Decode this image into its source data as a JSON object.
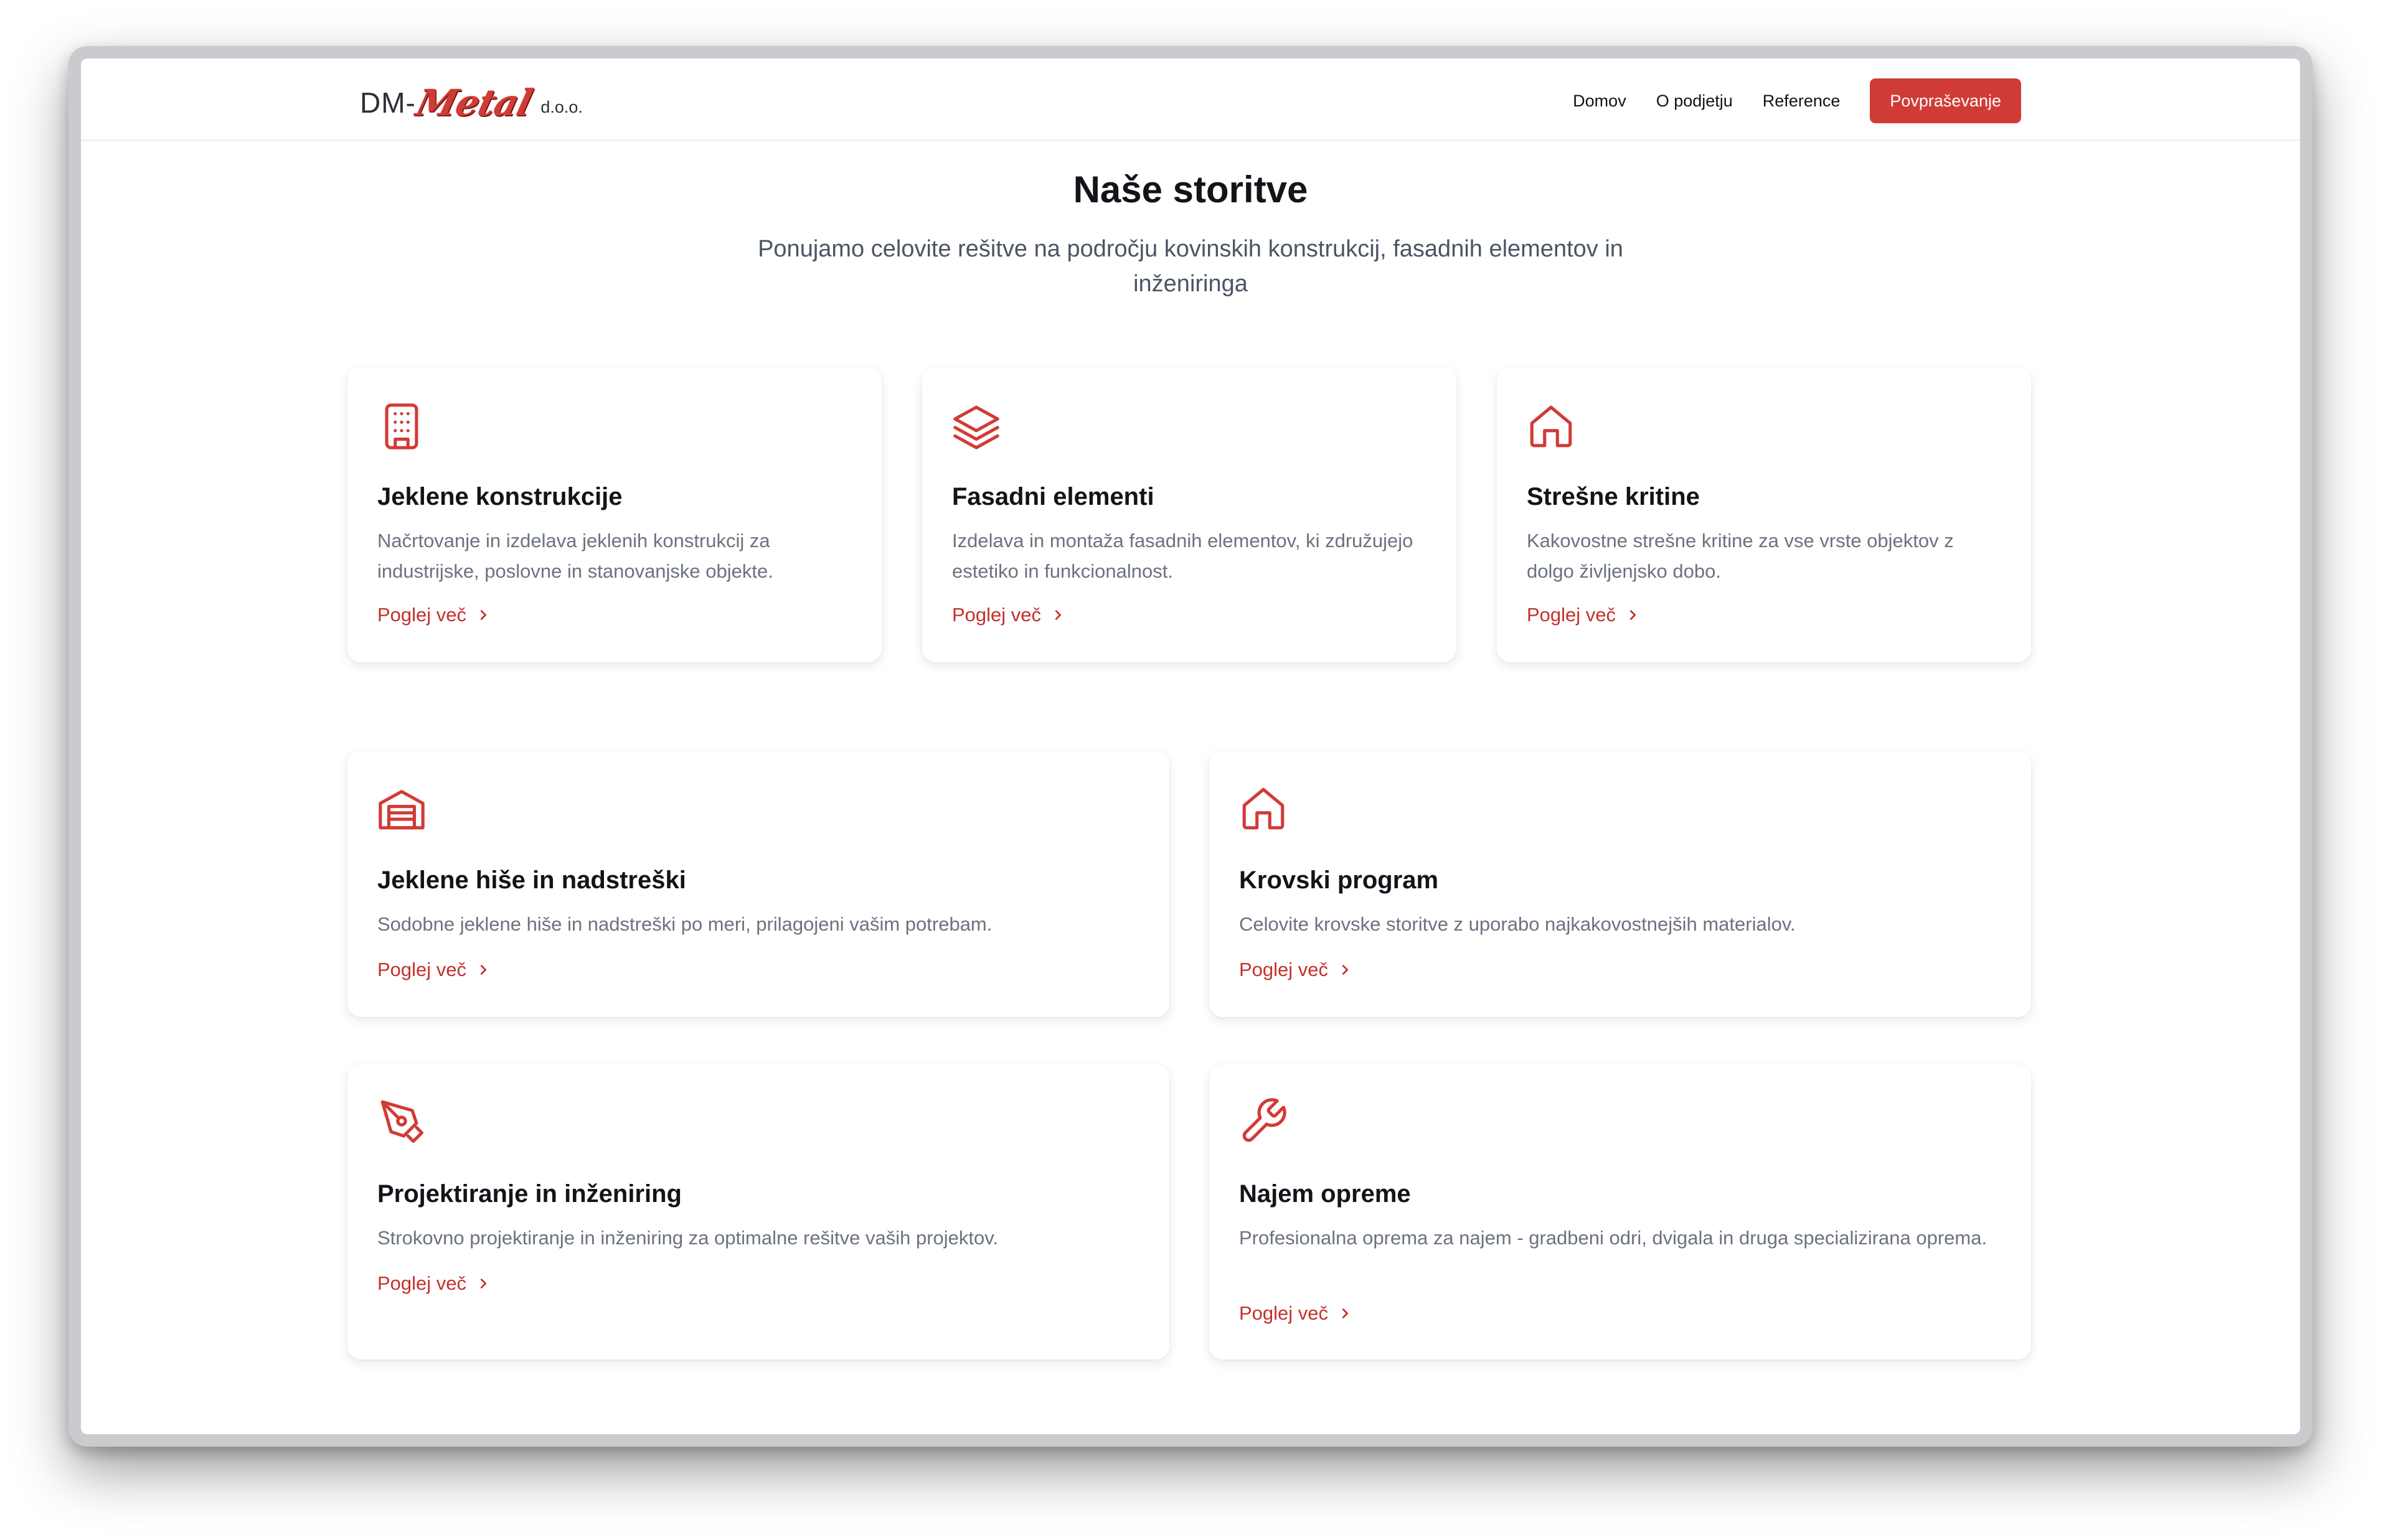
{
  "brand": {
    "logo_part1": "DM-",
    "logo_part2": "Metal",
    "logo_part3": "d.o.o.",
    "accent_color": "#d13b36"
  },
  "nav": {
    "items": [
      "Domov",
      "O podjetju",
      "Reference"
    ],
    "cta_label": "Povpraševanje"
  },
  "hero": {
    "title": "Naše storitve",
    "subtitle": "Ponujamo celovite rešitve na področju kovinskih konstrukcij, fasadnih elementov in inženiringa"
  },
  "services": [
    {
      "icon": "building-icon",
      "title": "Jeklene konstrukcije",
      "description": "Načrtovanje in izdelava jeklenih konstrukcij za industrijske, poslovne in stanovanjske objekte.",
      "link_label": "Poglej več"
    },
    {
      "icon": "layers-icon",
      "title": "Fasadni elementi",
      "description": "Izdelava in montaža fasadnih elementov, ki združujejo estetiko in funkcionalnost.",
      "link_label": "Poglej več"
    },
    {
      "icon": "home-icon",
      "title": "Strešne kritine",
      "description": "Kakovostne strešne kritine za vse vrste objektov z dolgo življenjsko dobo.",
      "link_label": "Poglej več"
    },
    {
      "icon": "warehouse-icon",
      "title": "Jeklene hiše in nadstreški",
      "description": "Sodobne jeklene hiše in nadstreški po meri, prilagojeni vašim potrebam.",
      "link_label": "Poglej več"
    },
    {
      "icon": "home-icon",
      "title": "Krovski program",
      "description": "Celovite krovske storitve z uporabo najkakovostnejših materialov.",
      "link_label": "Poglej več"
    },
    {
      "icon": "pen-tool-icon",
      "title": "Projektiranje in inženiring",
      "description": "Strokovno projektiranje in inženiring za optimalne rešitve vaših projektov.",
      "link_label": "Poglej več"
    },
    {
      "icon": "wrench-icon",
      "title": "Najem opreme",
      "description": "Profesionalna oprema za najem - gradbeni odri, dvigala in druga specializirana oprema.",
      "link_label": "Poglej več"
    }
  ]
}
